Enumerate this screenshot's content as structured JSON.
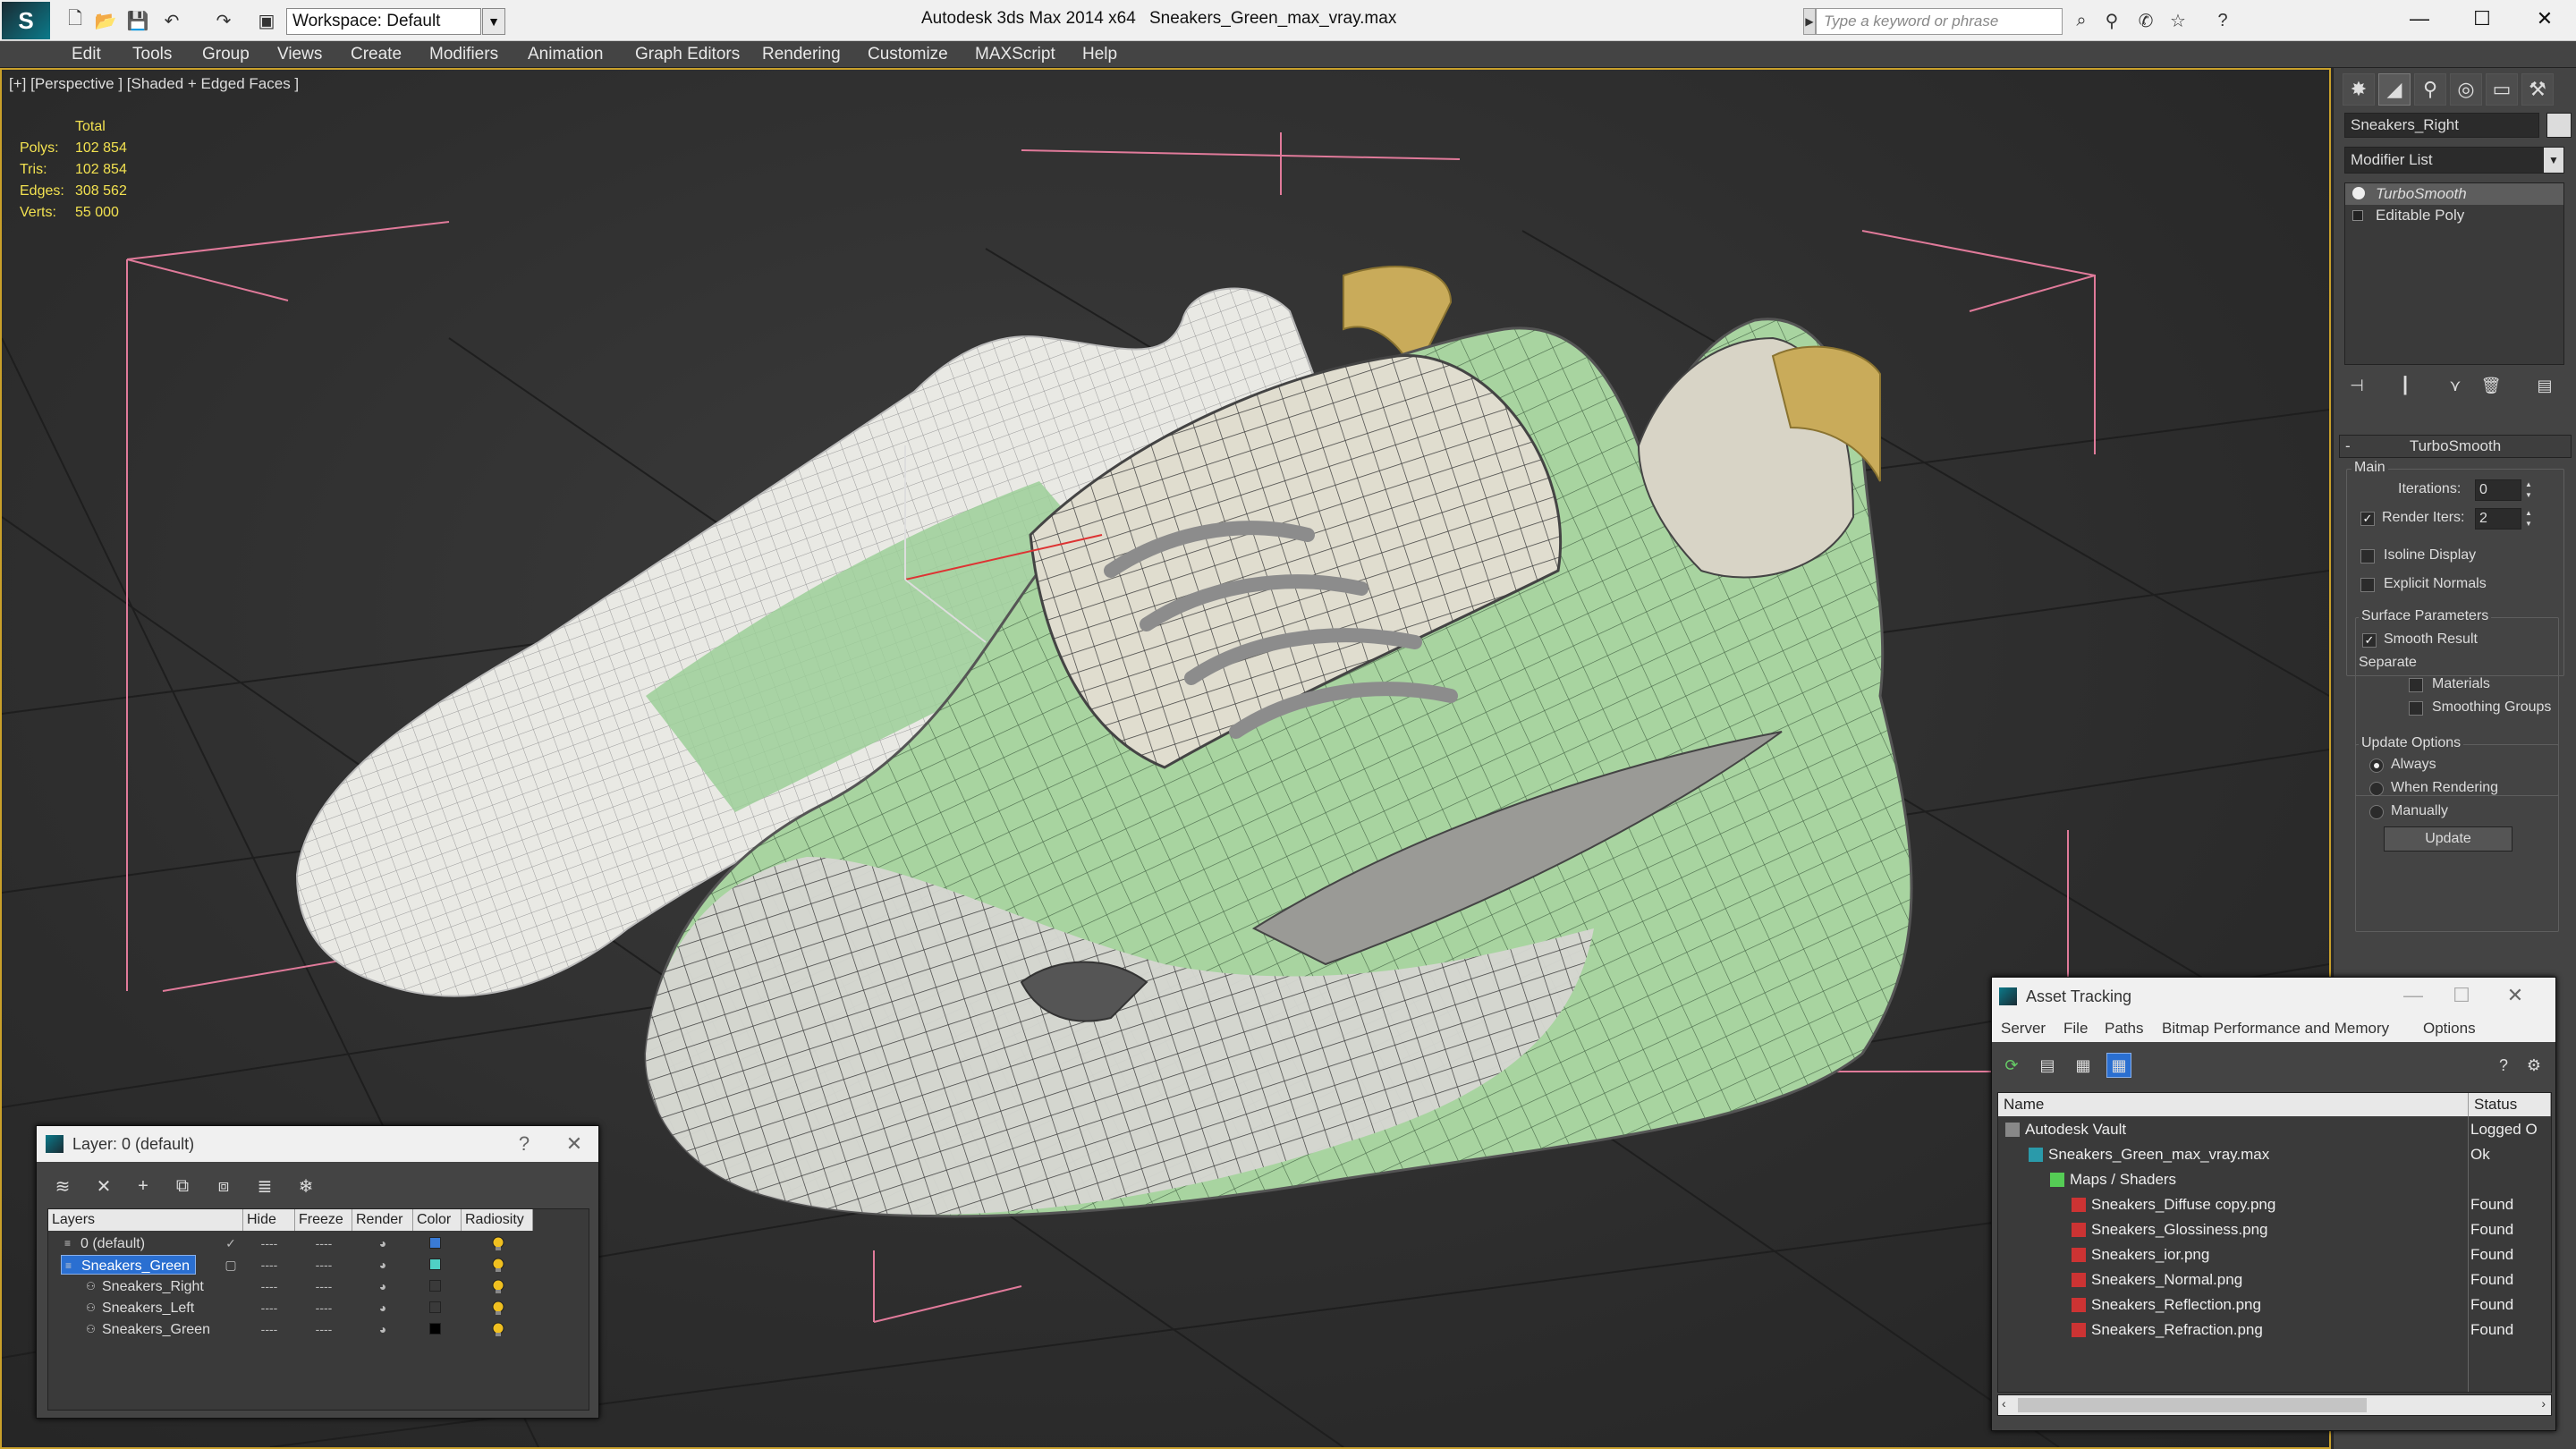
{
  "titlebar": {
    "workspace": "Workspace: Default",
    "app_title": "Autodesk 3ds Max  2014 x64",
    "file_title": "Sneakers_Green_max_vray.max",
    "search_placeholder": "Type a keyword or phrase"
  },
  "menu": [
    "Edit",
    "Tools",
    "Group",
    "Views",
    "Create",
    "Modifiers",
    "Animation",
    "Graph Editors",
    "Rendering",
    "Customize",
    "MAXScript",
    "Help"
  ],
  "viewport": {
    "label": "[+] [Perspective ] [Shaded + Edged Faces ]",
    "stats": {
      "header": "Total",
      "rows": [
        {
          "label": "Polys:",
          "value": "102 854"
        },
        {
          "label": "Tris:",
          "value": "102 854"
        },
        {
          "label": "Edges:",
          "value": "308 562"
        },
        {
          "label": "Verts:",
          "value": "55 000"
        }
      ]
    },
    "selection_color": "#c9a02a"
  },
  "command_panel": {
    "object_name": "Sneakers_Right",
    "modifier_list": "Modifier List",
    "stack": [
      "TurboSmooth",
      "Editable Poly"
    ],
    "rollout_title": "TurboSmooth",
    "main_group": "Main",
    "iterations_label": "Iterations:",
    "iterations_value": "0",
    "render_iters_label": "Render Iters:",
    "render_iters_value": "2",
    "isoline_label": "Isoline Display",
    "explicit_normals_label": "Explicit Normals",
    "surface_group": "Surface Parameters",
    "smooth_result_label": "Smooth Result",
    "separate_label": "Separate",
    "materials_label": "Materials",
    "smoothing_groups_label": "Smoothing Groups",
    "update_group": "Update Options",
    "always_label": "Always",
    "when_rendering_label": "When Rendering",
    "manually_label": "Manually",
    "update_button": "Update"
  },
  "layer_dialog": {
    "title": "Layer: 0 (default)",
    "help": "?",
    "columns": [
      "Layers",
      "Hide",
      "Freeze",
      "Render",
      "Color",
      "Radiosity"
    ],
    "rows": [
      {
        "name": "0 (default)",
        "color": "#3a7bd5"
      },
      {
        "name": "Sneakers_Green",
        "color": "#4fd1c5"
      },
      {
        "name": "Sneakers_Right",
        "color": "#3a3a3a"
      },
      {
        "name": "Sneakers_Left",
        "color": "#3a3a3a"
      },
      {
        "name": "Sneakers_Green",
        "color": "#000000"
      }
    ],
    "cell_dash": "----"
  },
  "asset_tracking": {
    "title": "Asset Tracking",
    "menu": [
      "Server",
      "File",
      "Paths",
      "Bitmap Performance and Memory",
      "Options"
    ],
    "columns": [
      "Name",
      "Status"
    ],
    "rows": [
      {
        "name": "Autodesk Vault",
        "status": "Logged O",
        "icon": "vault-icon"
      },
      {
        "name": "Sneakers_Green_max_vray.max",
        "status": "Ok",
        "icon": "max-file-icon"
      },
      {
        "name": "Maps / Shaders",
        "status": "",
        "icon": "maps-icon"
      },
      {
        "name": "Sneakers_Diffuse copy.png",
        "status": "Found",
        "icon": "png-icon"
      },
      {
        "name": "Sneakers_Glossiness.png",
        "status": "Found",
        "icon": "png-icon"
      },
      {
        "name": "Sneakers_ior.png",
        "status": "Found",
        "icon": "png-icon"
      },
      {
        "name": "Sneakers_Normal.png",
        "status": "Found",
        "icon": "png-icon"
      },
      {
        "name": "Sneakers_Reflection.png",
        "status": "Found",
        "icon": "png-icon"
      },
      {
        "name": "Sneakers_Refraction.png",
        "status": "Found",
        "icon": "png-icon"
      }
    ]
  }
}
